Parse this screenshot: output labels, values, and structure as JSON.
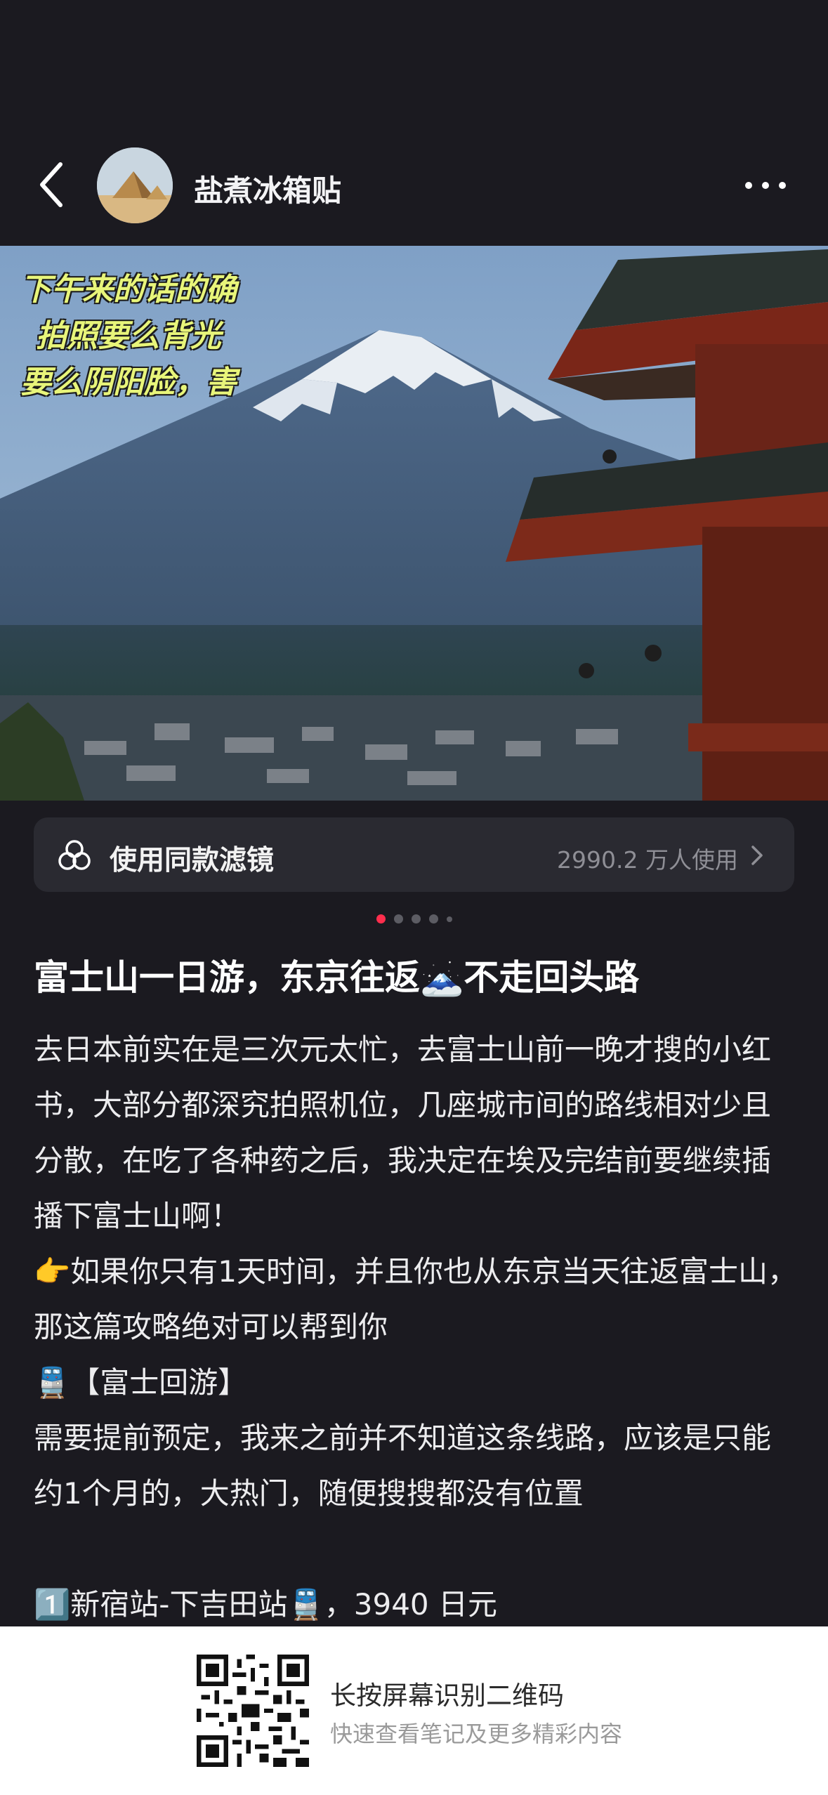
{
  "header": {
    "username": "盐煮冰箱贴",
    "back_icon": "chevron-left-icon",
    "more_icon": "ellipsis-icon"
  },
  "photo": {
    "overlay_text": "下午来的话的确\n拍照要么背光\n要么阴阳脸，害"
  },
  "filter": {
    "icon": "filter-circles-icon",
    "label": "使用同款滤镜",
    "count": "2990.2 万人使用"
  },
  "carousel": {
    "total": 5,
    "active_index": 0
  },
  "note": {
    "title": "富士山一日游，东京往返🗻不走回头路",
    "paragraphs": [
      "去日本前实在是三次元太忙，去富士山前一晚才搜的小红书，大部分都深究拍照机位，几座城市间的路线相对少且分散，在吃了各种药之后，我决定在埃及完结前要继续插播下富士山啊！",
      "👉如果你只有1天时间，并且你也从东京当天往返富士山，那这篇攻略绝对可以帮到你",
      "🚆【富士回游】",
      "需要提前预定，我来之前并不知道这条线路，应该是只能约1个月的，大热门，随便搜搜都没有位置",
      "",
      "1️⃣新宿站-下吉田站🚆，3940 日元"
    ]
  },
  "qr_bar": {
    "title": "长按屏幕识别二维码",
    "subtitle": "快速查看笔记及更多精彩内容"
  },
  "colors": {
    "background": "#1b1a20",
    "accent": "#ff2e4d",
    "overlay_text": "#e8f57a"
  }
}
